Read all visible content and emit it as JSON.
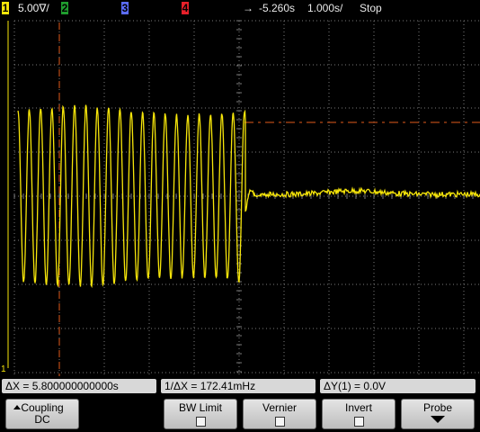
{
  "statusbar": {
    "ch1": {
      "number": "1",
      "scale": "5.00∇/",
      "color": "#f7e60a"
    },
    "ch2": {
      "number": "2",
      "color": "#1f9d2e"
    },
    "ch3": {
      "number": "3",
      "color": "#5b6cff"
    },
    "ch4": {
      "number": "4",
      "color": "#e8202a"
    },
    "trigger_arrow": "→",
    "delay": "-5.260s",
    "timebase": "1.000s/",
    "run_state": "Stop"
  },
  "screen": {
    "ground_marker": "1",
    "colors": {
      "grid": "#7a7a7a",
      "trace": "#f7e60a",
      "cursor": "#e25a1a"
    }
  },
  "readouts": {
    "delta_x": "ΔX = 5.800000000000s",
    "inv_delta_x": "1/ΔX = 172.41mHz",
    "delta_y": "ΔY(1) = 0.0V"
  },
  "softkeys": {
    "coupling": {
      "label": "Coupling",
      "value": "DC"
    },
    "bw_limit": {
      "label": "BW Limit"
    },
    "vernier": {
      "label": "Vernier"
    },
    "invert": {
      "label": "Invert"
    },
    "probe": {
      "label": "Probe"
    }
  }
}
